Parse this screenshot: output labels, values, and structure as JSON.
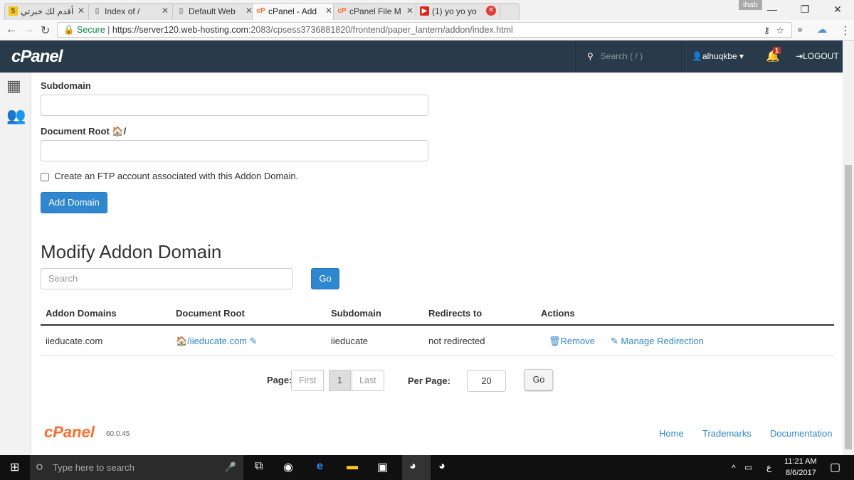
{
  "browser": {
    "tabs": [
      {
        "label": "أقدم لك خبرتي",
        "icon": "5"
      },
      {
        "label": "Index of /",
        "icon": "page"
      },
      {
        "label": "Default Web",
        "icon": "page"
      },
      {
        "label": "cPanel - Add",
        "icon": "cp",
        "active": true
      },
      {
        "label": "cPanel File M",
        "icon": "cp"
      },
      {
        "label": "(1) yo yo yo",
        "icon": "yt"
      }
    ],
    "profile": "ihab",
    "secure": "Secure",
    "url_host": "https://server120.web-hosting.com",
    "url_path": ":2083/cpsess3736881820/frontend/paper_lantern/addon/index.html"
  },
  "header": {
    "logo": "cPanel",
    "search_placeholder": "Search ( / )",
    "user": "alhuqkbe",
    "notifications": "1",
    "logout": "LOGOUT"
  },
  "form": {
    "subdomain_label": "Subdomain",
    "docroot_label": "Document Root",
    "docroot_suffix": "/",
    "ftp_label": "Create an FTP account associated with this Addon Domain.",
    "add_button": "Add Domain"
  },
  "modify": {
    "title": "Modify Addon Domain",
    "search_placeholder": "Search",
    "go": "Go",
    "columns": [
      "Addon Domains",
      "Document Root",
      "Subdomain",
      "Redirects to",
      "Actions"
    ],
    "rows": [
      {
        "domain": "iieducate.com",
        "docroot": "/iieducate.com",
        "subdomain": "iieducate",
        "redirect": "not redirected",
        "remove": "Remove",
        "manage": "Manage Redirection"
      }
    ]
  },
  "pagination": {
    "page_label": "Page:",
    "first": "First",
    "current": "1",
    "last": "Last",
    "per_page_label": "Per Page:",
    "per_page": "20",
    "go": "Go"
  },
  "footer": {
    "logo": "cPanel",
    "version": "60.0.45",
    "links": [
      "Home",
      "Trademarks",
      "Documentation"
    ]
  },
  "taskbar": {
    "search": "Type here to search",
    "time": "11:21 AM",
    "date": "8/6/2017",
    "lang": "ع"
  }
}
